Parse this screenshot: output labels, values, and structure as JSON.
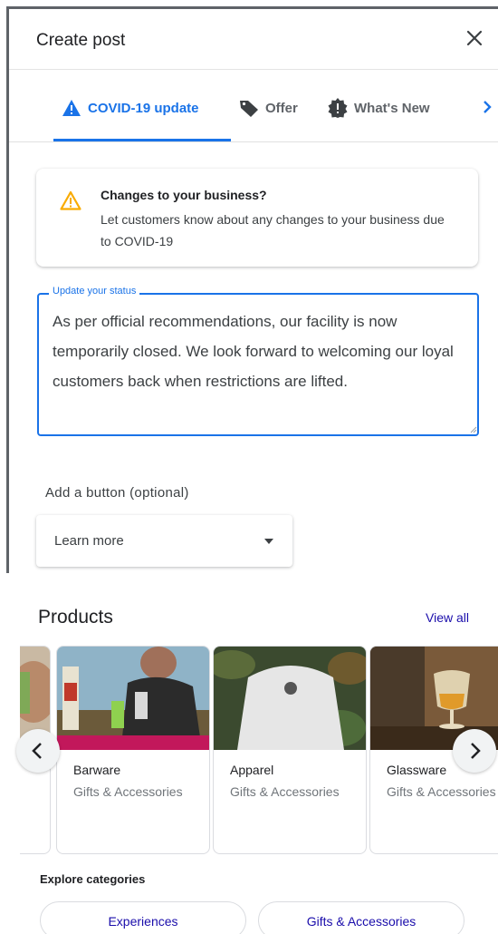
{
  "dialog": {
    "title": "Create post",
    "close_icon": "close-icon"
  },
  "tabs": [
    {
      "label": "COVID-19 update",
      "icon": "warning-icon",
      "active": true
    },
    {
      "label": "Offer",
      "icon": "tag-icon",
      "active": false
    },
    {
      "label": "What's New",
      "icon": "announcement-icon",
      "active": false
    }
  ],
  "notice": {
    "icon": "warning-icon",
    "title": "Changes to your business?",
    "body": "Let customers know about any changes to your business due to COVID-19"
  },
  "status_field": {
    "label": "Update your status",
    "value": "As per official recommendations, our facility is now temporarily closed. We look forward to welcoming our loyal customers back when restrictions are lifted."
  },
  "button_select": {
    "label": "Add a button (optional)",
    "value": "Learn more"
  },
  "products": {
    "title": "Products",
    "view_all": "View all",
    "items": [
      {
        "name": "Barware",
        "category": "Gifts & Accessories"
      },
      {
        "name": "Apparel",
        "category": "Gifts & Accessories"
      },
      {
        "name": "Glassware",
        "category": "Gifts & Accessories"
      }
    ],
    "explore_label": "Explore categories",
    "categories": [
      "Experiences",
      "Gifts & Accessories"
    ]
  },
  "colors": {
    "accent": "#1a73e8",
    "warning": "#f9ab00",
    "link": "#1a0dab"
  }
}
